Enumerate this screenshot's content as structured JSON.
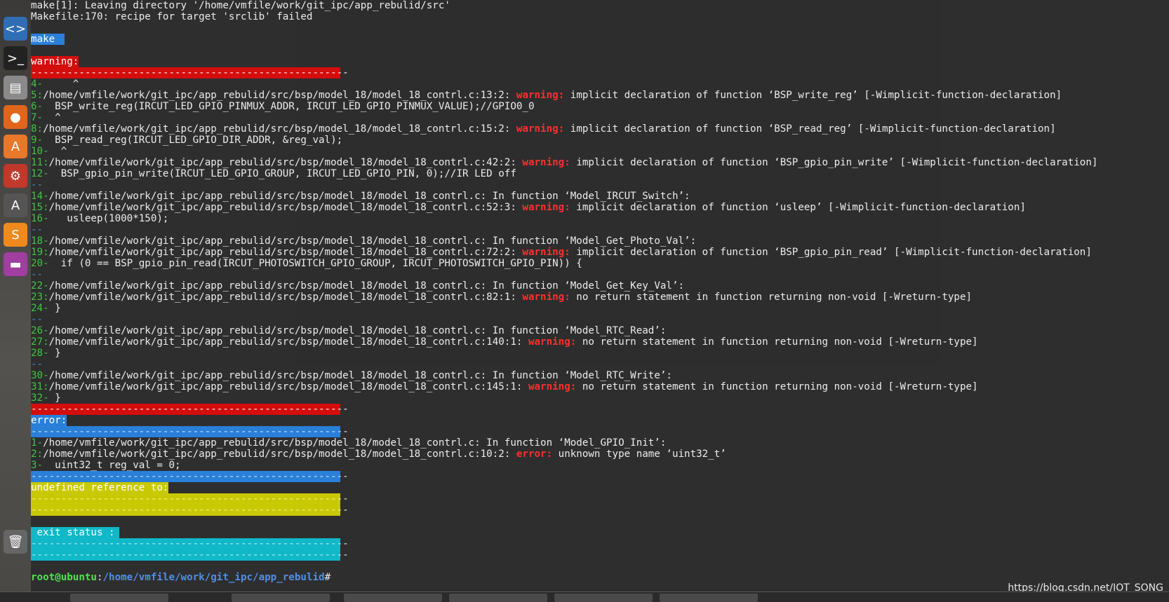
{
  "launcher": {
    "items": [
      {
        "name": "code-editor-icon",
        "glyph": "<>",
        "bg": "#2f6db5"
      },
      {
        "name": "terminal-icon",
        "glyph": ">_",
        "bg": "#222"
      },
      {
        "name": "file-manager-icon",
        "glyph": "▤",
        "bg": "#8a8a8a"
      },
      {
        "name": "firefox-icon",
        "glyph": "●",
        "bg": "#e0661c"
      },
      {
        "name": "software-center-icon",
        "glyph": "A",
        "bg": "#e8782a"
      },
      {
        "name": "settings-icon",
        "glyph": "⚙",
        "bg": "#c0392b"
      },
      {
        "name": "update-icon",
        "glyph": "A",
        "bg": "#555"
      },
      {
        "name": "sublime-icon",
        "glyph": "S",
        "bg": "#f08a1c"
      },
      {
        "name": "workspace-icon",
        "glyph": "▬",
        "bg": "#a03fa0"
      },
      {
        "name": "trash-icon",
        "glyph": "🗑",
        "bg": "#666"
      }
    ]
  },
  "terminal": {
    "line1": "make[1]: Leaving directory '/home/vmfile/work/git_ipc/app_rebulid/src'",
    "line2": "Makefile:170: recipe for target 'srclib' failed",
    "make_label": "make",
    "warning_label": "warning:",
    "dashes": "-----------------------------------------------------",
    "short_dash": "--",
    "entries": [
      {
        "n": "4-",
        "t": "     ^"
      },
      {
        "n": "5:",
        "t": "/home/vmfile/work/git_ipc/app_rebulid/src/bsp/model_18/model_18_contrl.c:13:2: ",
        "w": "warning:",
        "r": " implicit declaration of function ‘BSP_write_reg’ [-Wimplicit-function-declaration]"
      },
      {
        "n": "6-",
        "t": "  BSP_write_reg(IRCUT_LED_GPIO_PINMUX_ADDR, IRCUT_LED_GPIO_PINMUX_VALUE);//GPIO0_0"
      },
      {
        "n": "7-",
        "t": "  ^"
      },
      {
        "n": "8:",
        "t": "/home/vmfile/work/git_ipc/app_rebulid/src/bsp/model_18/model_18_contrl.c:15:2: ",
        "w": "warning:",
        "r": " implicit declaration of function ‘BSP_read_reg’ [-Wimplicit-function-declaration]"
      },
      {
        "n": "9-",
        "t": "  BSP_read_reg(IRCUT_LED_GPIO_DIR_ADDR, &reg_val);"
      },
      {
        "n": "10-",
        "t": "  ^"
      },
      {
        "n": "11:",
        "t": "/home/vmfile/work/git_ipc/app_rebulid/src/bsp/model_18/model_18_contrl.c:42:2: ",
        "w": "warning:",
        "r": " implicit declaration of function ‘BSP_gpio_pin_write’ [-Wimplicit-function-declaration]"
      },
      {
        "n": "12-",
        "t": "  BSP_gpio_pin_write(IRCUT_LED_GPIO_GROUP, IRCUT_LED_GPIO_PIN, 0);//IR LED off"
      },
      {
        "n": "--",
        "t": ""
      },
      {
        "n": "14-",
        "t": "/home/vmfile/work/git_ipc/app_rebulid/src/bsp/model_18/model_18_contrl.c: In function ‘Model_IRCUT_Switch’:"
      },
      {
        "n": "15:",
        "t": "/home/vmfile/work/git_ipc/app_rebulid/src/bsp/model_18/model_18_contrl.c:52:3: ",
        "w": "warning:",
        "r": " implicit declaration of function ‘usleep’ [-Wimplicit-function-declaration]"
      },
      {
        "n": "16-",
        "t": "   usleep(1000*150);"
      },
      {
        "n": "--",
        "t": ""
      },
      {
        "n": "18-",
        "t": "/home/vmfile/work/git_ipc/app_rebulid/src/bsp/model_18/model_18_contrl.c: In function ‘Model_Get_Photo_Val’:"
      },
      {
        "n": "19:",
        "t": "/home/vmfile/work/git_ipc/app_rebulid/src/bsp/model_18/model_18_contrl.c:72:2: ",
        "w": "warning:",
        "r": " implicit declaration of function ‘BSP_gpio_pin_read’ [-Wimplicit-function-declaration]"
      },
      {
        "n": "20-",
        "t": "  if (0 == BSP_gpio_pin_read(IRCUT_PHOTOSWITCH_GPIO_GROUP, IRCUT_PHOTOSWITCH_GPIO_PIN)) {"
      },
      {
        "n": "--",
        "t": ""
      },
      {
        "n": "22-",
        "t": "/home/vmfile/work/git_ipc/app_rebulid/src/bsp/model_18/model_18_contrl.c: In function ‘Model_Get_Key_Val’:"
      },
      {
        "n": "23:",
        "t": "/home/vmfile/work/git_ipc/app_rebulid/src/bsp/model_18/model_18_contrl.c:82:1: ",
        "w": "warning:",
        "r": " no return statement in function returning non-void [-Wreturn-type]"
      },
      {
        "n": "24-",
        "t": " }"
      },
      {
        "n": "--",
        "t": ""
      },
      {
        "n": "26-",
        "t": "/home/vmfile/work/git_ipc/app_rebulid/src/bsp/model_18/model_18_contrl.c: In function ‘Model_RTC_Read’:"
      },
      {
        "n": "27:",
        "t": "/home/vmfile/work/git_ipc/app_rebulid/src/bsp/model_18/model_18_contrl.c:140:1: ",
        "w": "warning:",
        "r": " no return statement in function returning non-void [-Wreturn-type]"
      },
      {
        "n": "28-",
        "t": " }"
      },
      {
        "n": "--",
        "t": ""
      },
      {
        "n": "30-",
        "t": "/home/vmfile/work/git_ipc/app_rebulid/src/bsp/model_18/model_18_contrl.c: In function ‘Model_RTC_Write’:"
      },
      {
        "n": "31:",
        "t": "/home/vmfile/work/git_ipc/app_rebulid/src/bsp/model_18/model_18_contrl.c:145:1: ",
        "w": "warning:",
        "r": " no return statement in function returning non-void [-Wreturn-type]"
      },
      {
        "n": "32-",
        "t": " }"
      }
    ],
    "error_label": "error:",
    "error_entries": [
      {
        "n": "1-",
        "t": "/home/vmfile/work/git_ipc/app_rebulid/src/bsp/model_18/model_18_contrl.c: In function ‘Model_GPIO_Init’:"
      },
      {
        "n": "2:",
        "t": "/home/vmfile/work/git_ipc/app_rebulid/src/bsp/model_18/model_18_contrl.c:10:2: ",
        "w": "error:",
        "r": " unknown type name ‘uint32_t’"
      },
      {
        "n": "3-",
        "t": "  uint32_t reg_val = 0;"
      }
    ],
    "undefined_label": "undefined reference to:",
    "exit_label": " exit status :",
    "prompt_user": "root@ubuntu",
    "prompt_sep": ":",
    "prompt_path": "/home/vmfile/work/git_ipc/app_rebulid",
    "prompt_end": "#"
  },
  "watermark": "https://blog.csdn.net/IOT_SONG"
}
